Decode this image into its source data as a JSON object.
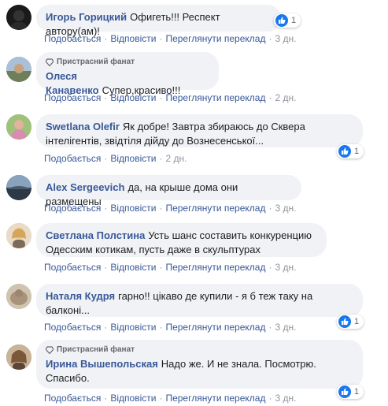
{
  "actions": {
    "like": "Подобається",
    "reply": "Відповісти",
    "translate": "Переглянути переклад",
    "separator": "·"
  },
  "fan_badge": "Пристрасний фанат",
  "comments": [
    {
      "author": "Игорь Горицкий",
      "text": "Офигеть!!! Респект автору(ам)!",
      "time": "3 дн.",
      "reactions": "1",
      "avatar_color": "#1a1a1a"
    },
    {
      "author": "Олеся Канавенко",
      "text": "Супер,красиво!!!",
      "time": "2 дн.",
      "fan": true,
      "avatar_color": "#8b9db0"
    },
    {
      "author": "Swetlana Olefir",
      "text": "Як добре! Завтра збираюсь до Сквера інтелігентів, звідтіля дійду до Вознесенської...",
      "time": "2 дн.",
      "reactions": "1",
      "avatar_color": "#c58fa8"
    },
    {
      "author": "Alex Sergeevich",
      "text": "да, на крыше дома они размещены",
      "time": "3 дн.",
      "avatar_color": "#5b6b7c"
    },
    {
      "author": "Светлана Полстина",
      "text": "Усть шанс составить конкуренцию Одесским котикам, пусть даже в скульптурах",
      "time": "3 дн.",
      "avatar_color": "#d9b27a"
    },
    {
      "author": "Наталя Кудря",
      "text": "гарно!! цікаво де купили - я б теж таку на балконі...",
      "time": "3 дн.",
      "reactions": "1",
      "avatar_color": "#b7a58c"
    },
    {
      "author": "Ирина Вышепольская",
      "text": "Надо же. И не знала. Посмотрю. Спасибо.",
      "time": "3 дн.",
      "reactions": "1",
      "fan": true,
      "avatar_color": "#9c7a5e"
    }
  ]
}
